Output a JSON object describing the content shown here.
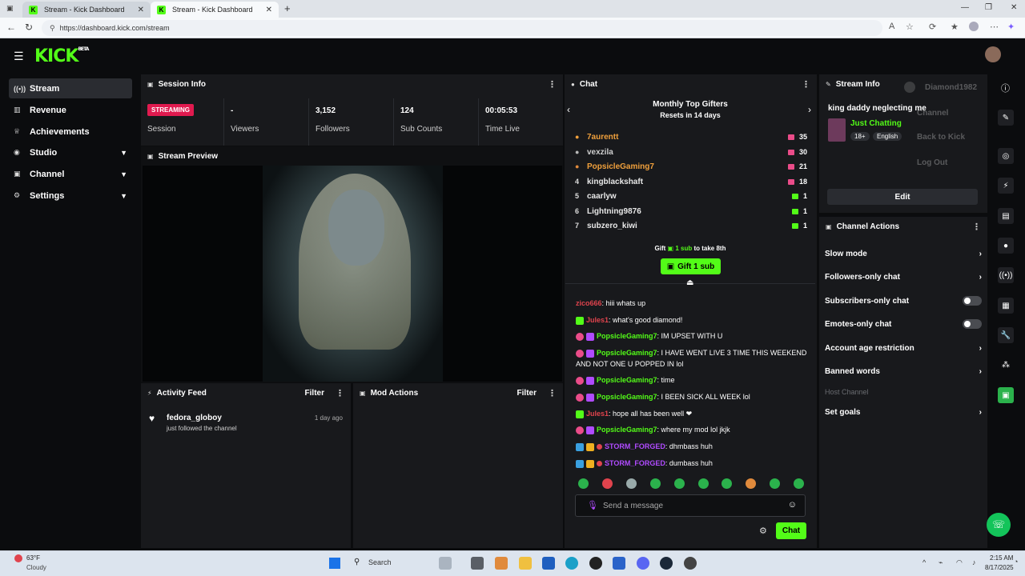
{
  "browser": {
    "tabs": [
      {
        "title": "Stream - Kick Dashboard"
      },
      {
        "title": "Stream - Kick Dashboard"
      }
    ],
    "url": "https://dashboard.kick.com/stream"
  },
  "app": {
    "logo": "KICK",
    "logo_tag": "BETA"
  },
  "sidebar": {
    "items": [
      {
        "label": "Stream",
        "icon": "broadcast-icon"
      },
      {
        "label": "Revenue",
        "icon": "revenue-icon"
      },
      {
        "label": "Achievements",
        "icon": "trophy-icon"
      },
      {
        "label": "Studio",
        "icon": "studio-icon"
      },
      {
        "label": "Channel",
        "icon": "channel-icon"
      },
      {
        "label": "Settings",
        "icon": "gear-icon"
      }
    ]
  },
  "session": {
    "title": "Session Info",
    "status": "STREAMING",
    "status_label": "Session",
    "stats": [
      {
        "value": "-",
        "label": "Viewers"
      },
      {
        "value": "3,152",
        "label": "Followers"
      },
      {
        "value": "124",
        "label": "Sub Counts"
      },
      {
        "value": "00:05:53",
        "label": "Time Live"
      }
    ]
  },
  "preview": {
    "title": "Stream Preview"
  },
  "activity": {
    "title": "Activity Feed",
    "filter": "Filter",
    "items": [
      {
        "user": "fedora_globoy",
        "action": "just followed the channel",
        "time": "1 day ago"
      }
    ]
  },
  "mod": {
    "title": "Mod Actions",
    "filter": "Filter"
  },
  "chat": {
    "title": "Chat",
    "gifters_title": "Monthly Top Gifters",
    "gifters_sub": "Resets in 14 days",
    "gifters": [
      {
        "rank": "",
        "name": "7aurentt",
        "count": "35"
      },
      {
        "rank": "",
        "name": "vexzila",
        "count": "30"
      },
      {
        "rank": "",
        "name": "PopsicleGaming7",
        "count": "21"
      },
      {
        "rank": "4",
        "name": "kingblackshaft",
        "count": "18"
      },
      {
        "rank": "5",
        "name": "caarlyw",
        "count": "1"
      },
      {
        "rank": "6",
        "name": "Lightning9876",
        "count": "1"
      },
      {
        "rank": "7",
        "name": "subzero_kiwi",
        "count": "1"
      }
    ],
    "gift_prompt_pre": "Gift",
    "gift_prompt_mid": "1 sub",
    "gift_prompt_post": "to take 8th",
    "gift_button": "Gift 1 sub",
    "messages": [
      {
        "user": "zico666",
        "text": "hiii whats up"
      },
      {
        "user": "Jules1",
        "text": "what's good diamond!"
      },
      {
        "user": "PopsicleGaming7",
        "text": "IM UPSET WITH U"
      },
      {
        "user": "PopsicleGaming7",
        "text": "I HAVE WENT LIVE 3 TIME THIS WEEKEND AND NOT ONE U POPPED IN lol"
      },
      {
        "user": "PopsicleGaming7",
        "text": "time"
      },
      {
        "user": "PopsicleGaming7",
        "text": "I BEEN SICK ALL WEEK lol"
      },
      {
        "user": "Jules1",
        "text": "hope all has been well ❤"
      },
      {
        "user": "PopsicleGaming7",
        "text": "where my mod lol jkjk"
      },
      {
        "user": "STORM_FORGED",
        "text": "dhmbass huh"
      },
      {
        "user": "STORM_FORGED",
        "text": "dumbass huh"
      }
    ],
    "input_placeholder": "Send a message",
    "send_button": "Chat"
  },
  "stream_info": {
    "title": "Stream Info",
    "stream_title": "king daddy neglecting me",
    "category": "Just Chatting",
    "tags": [
      "18+",
      "English"
    ],
    "edit": "Edit",
    "dropdown": {
      "user": "Diamond1982",
      "items": [
        "Channel",
        "Back to Kick",
        "Log Out"
      ]
    }
  },
  "channel_actions": {
    "title": "Channel Actions",
    "rows": [
      {
        "label": "Slow mode",
        "kind": "arrow"
      },
      {
        "label": "Followers-only chat",
        "kind": "arrow"
      },
      {
        "label": "Subscribers-only chat",
        "kind": "toggle"
      },
      {
        "label": "Emotes-only chat",
        "kind": "toggle"
      },
      {
        "label": "Account age restriction",
        "kind": "arrow"
      },
      {
        "label": "Banned words",
        "kind": "arrow"
      },
      {
        "label": "Host Channel",
        "kind": "disabled"
      },
      {
        "label": "Set goals",
        "kind": "arrow"
      }
    ]
  },
  "taskbar": {
    "weather_temp": "63°F",
    "weather_desc": "Cloudy",
    "search": "Search",
    "time": "2:15 AM",
    "date": "8/17/2025"
  },
  "colors": {
    "kick_green": "#53fc18",
    "live_red": "#e01a4f",
    "panel": "#18191c",
    "bg": "#0b0c0e"
  }
}
